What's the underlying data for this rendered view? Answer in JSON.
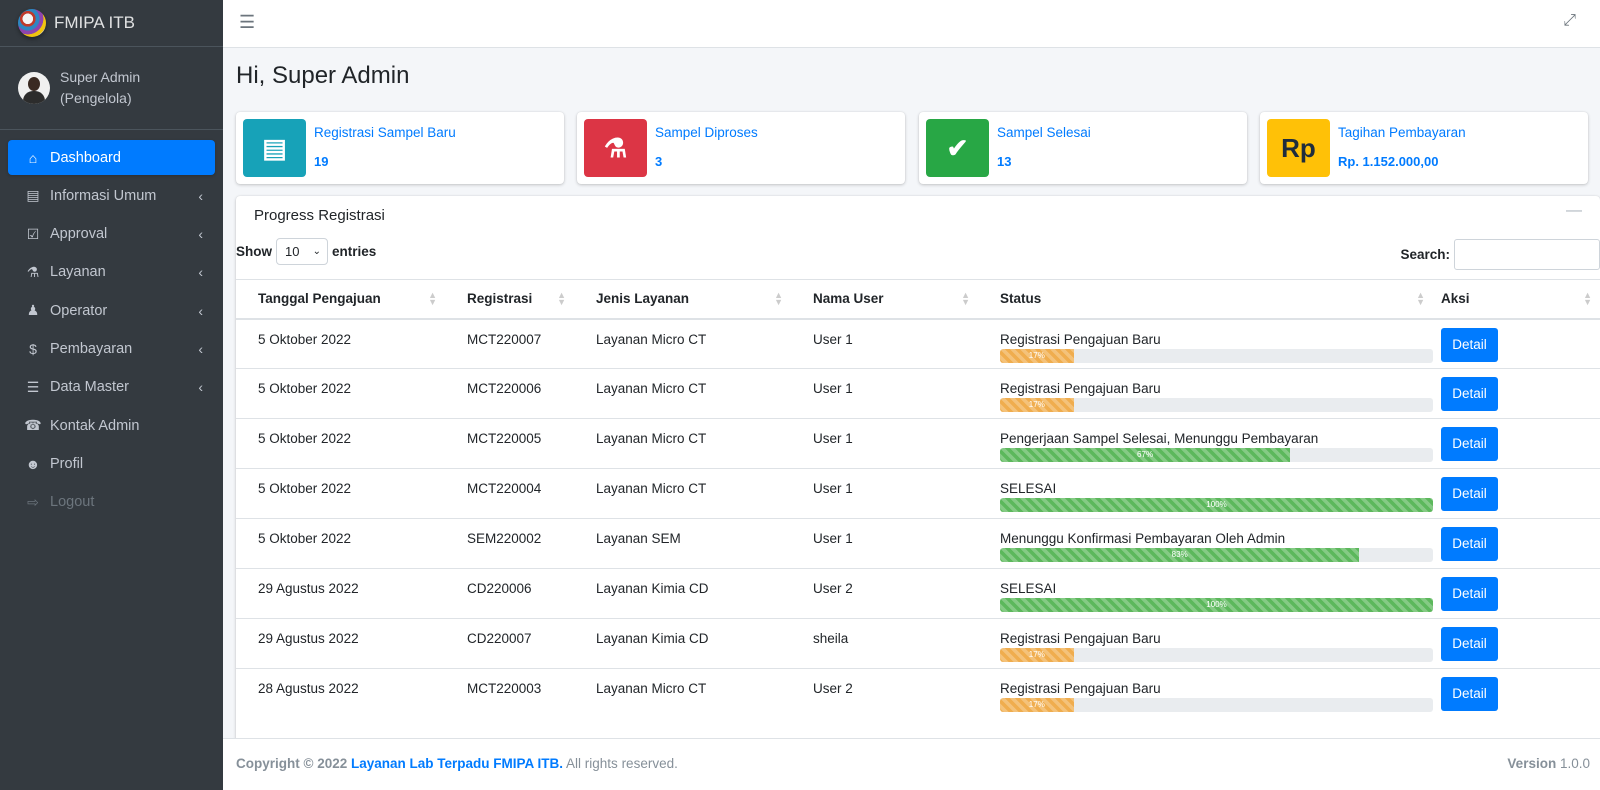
{
  "brand": {
    "title": "FMIPA ITB",
    "logo_icon": "fmipa-logo"
  },
  "user": {
    "name": "Super Admin (Pengelola)"
  },
  "sidebar": {
    "items": [
      {
        "label": "Dashboard",
        "icon": "home-icon"
      },
      {
        "label": "Informasi Umum",
        "icon": "book-icon"
      },
      {
        "label": "Approval",
        "icon": "clipboard-check-icon"
      },
      {
        "label": "Layanan",
        "icon": "flask-icon"
      },
      {
        "label": "Operator",
        "icon": "user-tie-icon"
      },
      {
        "label": "Pembayaran",
        "icon": "dollar-icon"
      },
      {
        "label": "Data Master",
        "icon": "database-icon"
      },
      {
        "label": "Kontak Admin",
        "icon": "headset-icon"
      },
      {
        "label": "Profil",
        "icon": "user-icon"
      },
      {
        "label": "Logout",
        "icon": "sign-out-icon"
      }
    ]
  },
  "header": {
    "menu_icon": "hamburger-icon",
    "fullscreen_icon": "expand-icon"
  },
  "greeting": "Hi, Super Admin",
  "info_boxes": [
    {
      "label": "Registrasi Sampel Baru",
      "value": "19",
      "color": "#17a2b8",
      "icon": "file-icon"
    },
    {
      "label": "Sampel Diproses",
      "value": "3",
      "color": "#dc3545",
      "icon": "flask-icon"
    },
    {
      "label": "Sampel Selesai",
      "value": "13",
      "color": "#28a745",
      "icon": "check-circle-icon"
    },
    {
      "label": "Tagihan Pembayaran",
      "value": "Rp. 1.152.000,00",
      "color": "#ffc107",
      "icon_text": "Rp"
    }
  ],
  "progress_card": {
    "title": "Progress Registrasi",
    "show_label": "Show",
    "entries_value": "10",
    "entries_label": "entries",
    "search_label": "Search:",
    "columns": [
      "Tanggal Pengajuan",
      "Registrasi",
      "Jenis Layanan",
      "Nama User",
      "Status",
      "Aksi"
    ],
    "rows": [
      {
        "tanggal": "5 Oktober 2022",
        "registrasi": "MCT220007",
        "layanan": "Layanan Micro CT",
        "user": "User 1",
        "status": "Registrasi Pengajuan Baru",
        "progress": 17,
        "progress_label": "17%",
        "bar": "warning",
        "action": "Detail"
      },
      {
        "tanggal": "5 Oktober 2022",
        "registrasi": "MCT220006",
        "layanan": "Layanan Micro CT",
        "user": "User 1",
        "status": "Registrasi Pengajuan Baru",
        "progress": 17,
        "progress_label": "17%",
        "bar": "warning",
        "action": "Detail"
      },
      {
        "tanggal": "5 Oktober 2022",
        "registrasi": "MCT220005",
        "layanan": "Layanan Micro CT",
        "user": "User 1",
        "status": "Pengerjaan Sampel Selesai, Menunggu Pembayaran",
        "progress": 67,
        "progress_label": "67%",
        "bar": "success",
        "action": "Detail"
      },
      {
        "tanggal": "5 Oktober 2022",
        "registrasi": "MCT220004",
        "layanan": "Layanan Micro CT",
        "user": "User 1",
        "status": "SELESAI",
        "progress": 100,
        "progress_label": "100%",
        "bar": "success",
        "action": "Detail"
      },
      {
        "tanggal": "5 Oktober 2022",
        "registrasi": "SEM220002",
        "layanan": "Layanan SEM",
        "user": "User 1",
        "status": "Menunggu Konfirmasi Pembayaran Oleh Admin",
        "progress": 83,
        "progress_label": "83%",
        "bar": "success",
        "action": "Detail"
      },
      {
        "tanggal": "29 Agustus 2022",
        "registrasi": "CD220006",
        "layanan": "Layanan Kimia CD",
        "user": "User 2",
        "status": "SELESAI",
        "progress": 100,
        "progress_label": "100%",
        "bar": "success",
        "action": "Detail"
      },
      {
        "tanggal": "29 Agustus 2022",
        "registrasi": "CD220007",
        "layanan": "Layanan Kimia CD",
        "user": "sheila",
        "status": "Registrasi Pengajuan Baru",
        "progress": 17,
        "progress_label": "17%",
        "bar": "warning",
        "action": "Detail"
      },
      {
        "tanggal": "28 Agustus 2022",
        "registrasi": "MCT220003",
        "layanan": "Layanan Micro CT",
        "user": "User 2",
        "status": "Registrasi Pengajuan Baru",
        "progress": 17,
        "progress_label": "17%",
        "bar": "warning",
        "action": "Detail"
      }
    ]
  },
  "footer": {
    "copyright": "Copyright © 2022",
    "link": "Layanan Lab Terpadu FMIPA ITB.",
    "rights": "All rights reserved.",
    "version_label": "Version",
    "version": "1.0.0"
  }
}
